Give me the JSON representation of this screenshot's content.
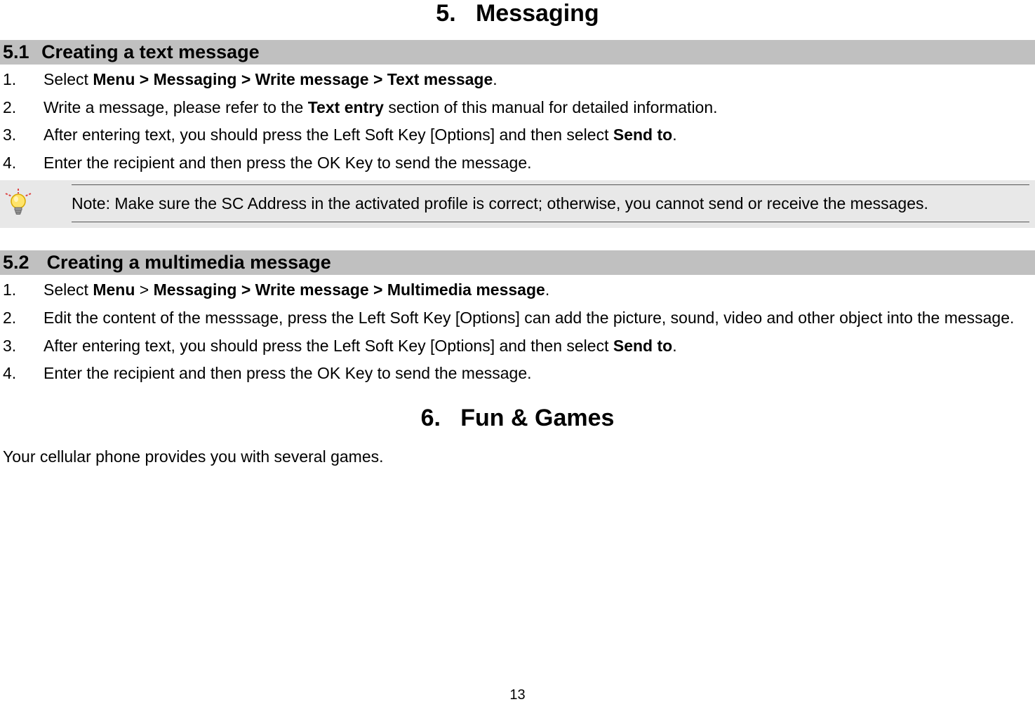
{
  "chapter5": {
    "number": "5.",
    "title": "Messaging"
  },
  "section51": {
    "number": "5.1",
    "title": "Creating a text message",
    "items": [
      {
        "num": "1.",
        "pre": "Select ",
        "bold": "Menu > Messaging > Write message > Text message",
        "post": "."
      },
      {
        "num": "2.",
        "pre": "Write a message, please refer to the ",
        "bold": "Text entry",
        "post": " section of this manual for detailed information."
      },
      {
        "num": "3.",
        "pre": "After entering text, you should press the Left Soft Key [Options] and then select ",
        "bold": "Send to",
        "post": "."
      },
      {
        "num": "4.",
        "pre": "Enter the recipient and then press the OK Key to send the message.",
        "bold": "",
        "post": ""
      }
    ]
  },
  "note": {
    "text": "Note: Make sure the SC Address in the activated profile is correct; otherwise, you cannot send or receive the messages.",
    "icon": "lightbulb-tip-icon"
  },
  "section52": {
    "number": "5.2",
    "title": "Creating a multimedia message",
    "items": [
      {
        "num": "1.",
        "pre": "Select ",
        "bold": "Menu",
        "mid": " > ",
        "bold2": "Messaging > Write message > Multimedia message",
        "post": "."
      },
      {
        "num": "2.",
        "pre": "Edit the content of the messsage, press the Left Soft Key [Options] can add the picture, sound, video and other object into the message.",
        "bold": "",
        "post": ""
      },
      {
        "num": "3.",
        "pre": "After entering text, you should press the Left Soft Key [Options] and then select ",
        "bold": "Send to",
        "post": "."
      },
      {
        "num": "4.",
        "pre": "Enter the recipient and then press the OK Key to send the message.",
        "bold": "",
        "post": ""
      }
    ]
  },
  "chapter6": {
    "number": "6.",
    "title": "Fun & Games"
  },
  "chapter6_intro": "Your cellular phone provides you with several games.",
  "pageNumber": "13"
}
